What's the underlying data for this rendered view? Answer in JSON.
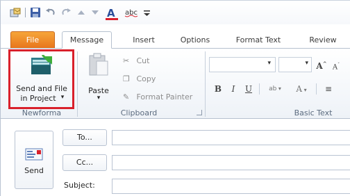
{
  "quick_access": {
    "icons": [
      "save-icon",
      "undo-icon",
      "redo-icon",
      "previous-item-icon",
      "next-item-icon",
      "format-text-icon",
      "spelling-icon",
      "customize-icon"
    ]
  },
  "tabs": [
    {
      "label": "File"
    },
    {
      "label": "Message"
    },
    {
      "label": "Insert"
    },
    {
      "label": "Options"
    },
    {
      "label": "Format Text"
    },
    {
      "label": "Review"
    }
  ],
  "ribbon": {
    "newforma": {
      "button_line1": "Send and File",
      "button_line2": "in Project",
      "dropdown_glyph": "▾",
      "group_label": "Newforma"
    },
    "clipboard": {
      "paste": "Paste",
      "cut": "Cut",
      "copy": "Copy",
      "format_painter": "Format Painter",
      "group_label": "Clipboard"
    },
    "basic_text": {
      "bold": "B",
      "italic": "I",
      "underline": "U",
      "group_label": "Basic Text"
    }
  },
  "compose": {
    "send_label": "Send",
    "to_label": "To...",
    "cc_label": "Cc...",
    "subject_label": "Subject:"
  },
  "colors": {
    "file_tab": "#e8761c",
    "highlight_box": "#d9202b",
    "accent_green": "#3fae3a"
  }
}
